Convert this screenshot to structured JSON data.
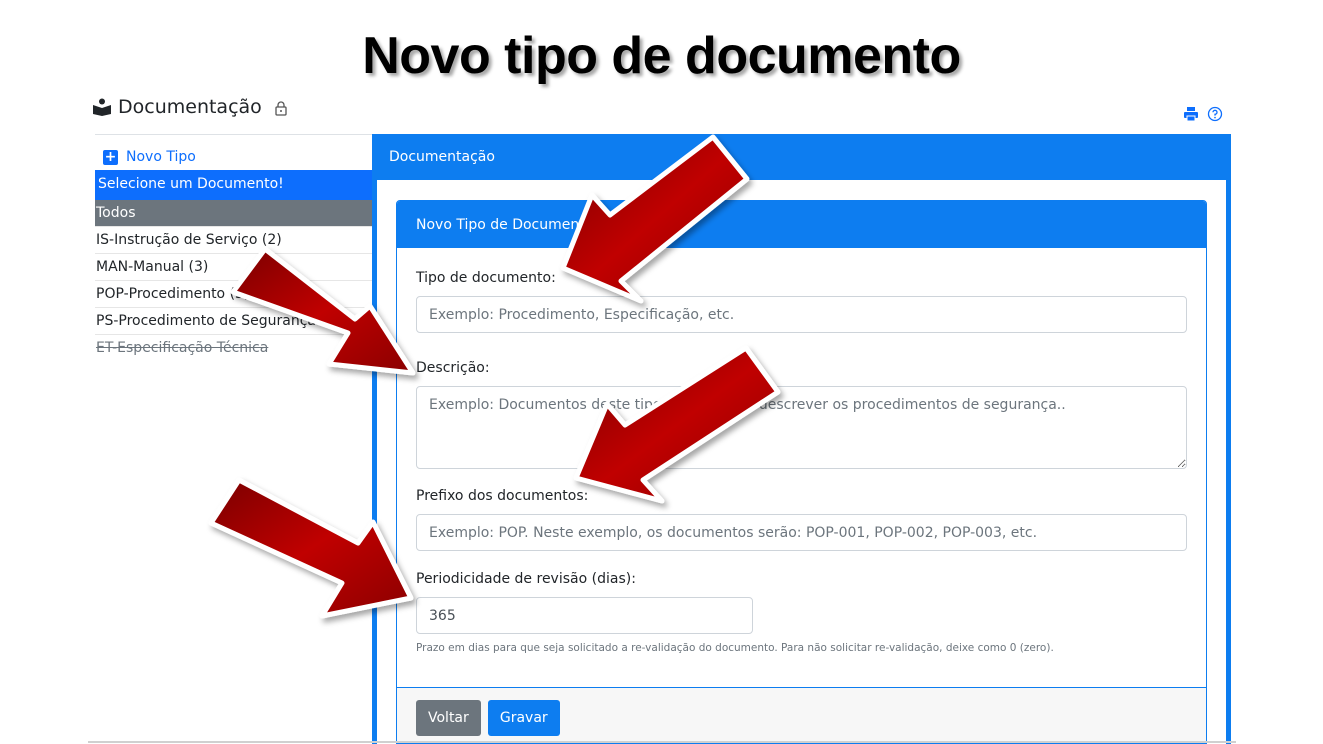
{
  "slide": {
    "title": "Novo tipo de documento"
  },
  "app": {
    "title": "Documentação"
  },
  "sidebar": {
    "new_type_label": "Novo Tipo",
    "select_prompt": "Selecione um Documento!",
    "items": [
      {
        "label": "Todos"
      },
      {
        "label": "IS-Instrução de Serviço (2)"
      },
      {
        "label": "MAN-Manual (3)"
      },
      {
        "label": "POP-Procedimento (3)"
      },
      {
        "label": "PS-Procedimento de Segurança"
      },
      {
        "label": "ET-Especificação Técnica"
      }
    ]
  },
  "main": {
    "header": "Documentação"
  },
  "form": {
    "card_title": "Novo Tipo de Documento",
    "doc_type_label": "Tipo de documento:",
    "doc_type_placeholder": "Exemplo: Procedimento, Especificação, etc.",
    "description_label": "Descrição:",
    "description_placeholder": "Exemplo: Documentos deste tipo servem para descrever os procedimentos de segurança..",
    "prefix_label": "Prefixo dos documentos:",
    "prefix_placeholder": "Exemplo: POP. Neste exemplo, os documentos serão: POP-001, POP-002, POP-003, etc.",
    "review_label": "Periodicidade de revisão (dias):",
    "review_value": "365",
    "review_help": "Prazo em dias para que seja solicitado a re-validação do documento. Para não solicitar re-validação, deixe como 0 (zero).",
    "back_button": "Voltar",
    "save_button": "Gravar"
  },
  "colors": {
    "primary": "#0d7df0",
    "active_item": "#6c757d",
    "arrow": "#b00000"
  },
  "icons": {
    "app": "book-reader-icon",
    "lock": "lock-icon",
    "print": "print-icon",
    "help": "help-icon",
    "add": "plus-square-icon"
  }
}
